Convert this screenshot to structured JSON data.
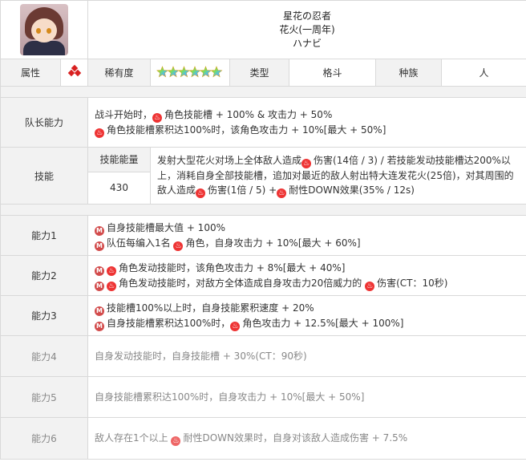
{
  "header": {
    "name_jp": "星花の忍者",
    "title": "花火(一周年)",
    "kana": "ハナビ"
  },
  "attr": {
    "attr_label": "属性",
    "rarity_label": "稀有度",
    "type_label": "类型",
    "type_value": "格斗",
    "race_label": "种族",
    "race_value": "人",
    "stars": 6
  },
  "leader": {
    "label": "队长能力",
    "line1_prefix": "战斗开始时，",
    "line1_text": "角色技能槽 + 100% & 攻击力 + 50%",
    "line2_text": "角色技能槽累积达100%时，该角色攻击力 + 10%[最大 + 50%]"
  },
  "skill": {
    "label": "技能",
    "energy_label": "技能能量",
    "energy_value": "430",
    "desc_1": "发射大型花火对场上全体敌人造成",
    "desc_2": "伤害(14倍 / 3) / 若技能发动技能槽达200%以上，消耗自身全部技能槽，追加对最近的敌人射出特大连发花火(25倍)，对其周围的敌人造成",
    "desc_3": "伤害(1倍 / 5) +",
    "desc_4": "耐性DOWN效果(35% / 12s)"
  },
  "abilities": [
    {
      "label": "能力1",
      "l1": "自身技能槽最大值 + 100%",
      "l2a": "队伍每编入1名",
      "l2b": "角色，自身攻击力 + 10%[最大 + 60%]"
    },
    {
      "label": "能力2",
      "l1": "角色发动技能时，该角色攻击力 + 8%[最大 + 40%]",
      "l2a": "角色发动技能时，对敌方全体造成自身攻击力20倍威力的",
      "l2b": "伤害(CT：10秒)"
    },
    {
      "label": "能力3",
      "l1": "技能槽100%以上时，自身技能累积速度 + 20%",
      "l2a": "自身技能槽累积达100%时，",
      "l2b": "角色攻击力 + 12.5%[最大 + 100%]"
    },
    {
      "label": "能力4",
      "text": "自身发动技能时，自身技能槽 + 30%(CT：90秒)"
    },
    {
      "label": "能力5",
      "text": "自身技能槽累积达100%时，自身攻击力 + 10%[最大 + 50%]"
    },
    {
      "label": "能力6",
      "text_a": "敌人存在1个以上",
      "text_b": "耐性DOWN效果时，自身对该敌人造成伤害 + 7.5%"
    }
  ],
  "icons": {
    "fire": "fire-icon",
    "m": "m-badge-icon",
    "attr": "triple-diamond-icon",
    "star": "rainbow-star-icon"
  },
  "colors": {
    "fire": "#e33333",
    "label_bg": "#f2f2f2",
    "border": "#d9d9d9"
  }
}
